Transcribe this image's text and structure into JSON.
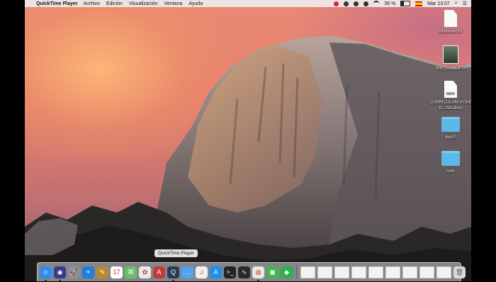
{
  "menubar": {
    "app_name": "QuickTime Player",
    "menus": [
      "Archivo",
      "Edición",
      "Visualización",
      "Ventana",
      "Ayuda"
    ],
    "battery": "36 %",
    "clock": "Mar 13:07"
  },
  "desktop": {
    "icons": [
      {
        "label": "Windows 10",
        "kind": "document"
      },
      {
        "label": "IMG_9586.JPG",
        "kind": "image"
      },
      {
        "label": "CURRICULUM VITAE D...SIA.docx",
        "kind": "docx",
        "tag": "DOCX"
      },
      {
        "label": "jeyci7",
        "kind": "folder"
      },
      {
        "label": "usb",
        "kind": "folder"
      }
    ]
  },
  "dock": {
    "tooltip": "QuickTime Player",
    "apps": [
      {
        "name": "finder-icon",
        "color": "#2f8df0",
        "glyph": "☺"
      },
      {
        "name": "siri-icon",
        "color": "#3a3a8c",
        "glyph": "◉"
      },
      {
        "name": "launchpad-icon",
        "color": "#8a9099",
        "glyph": "🚀"
      },
      {
        "name": "safari-icon",
        "color": "#1e7fe0",
        "glyph": "⌖"
      },
      {
        "name": "notes-icon",
        "color": "#b8892e",
        "glyph": "✎"
      },
      {
        "name": "calendar-icon",
        "color": "#ffffff",
        "glyph": "17"
      },
      {
        "name": "maps-icon",
        "color": "#6bbf6b",
        "glyph": "⌘"
      },
      {
        "name": "photos-icon",
        "color": "#e9e9e9",
        "glyph": "✿"
      },
      {
        "name": "textedit-icon",
        "color": "#c23b3b",
        "glyph": "A"
      },
      {
        "name": "quicktime-icon",
        "color": "#2b3a5a",
        "glyph": "Q"
      },
      {
        "name": "messages-icon",
        "color": "#4fa3f2",
        "glyph": "…"
      },
      {
        "name": "itunes-icon",
        "color": "#f0f0f0",
        "glyph": "♫"
      },
      {
        "name": "appstore-icon",
        "color": "#1d8ff0",
        "glyph": "A"
      },
      {
        "name": "terminal-icon",
        "color": "#222222",
        "glyph": ">_"
      },
      {
        "name": "activity-monitor-icon",
        "color": "#2a2a2a",
        "glyph": "∿"
      },
      {
        "name": "chrome-icon",
        "color": "#e8e8e8",
        "glyph": "◍"
      },
      {
        "name": "facetime-icon",
        "color": "#3db84a",
        "glyph": "▣"
      },
      {
        "name": "feedly-icon",
        "color": "#2bb24c",
        "glyph": "◆"
      }
    ],
    "right_items": 9
  }
}
